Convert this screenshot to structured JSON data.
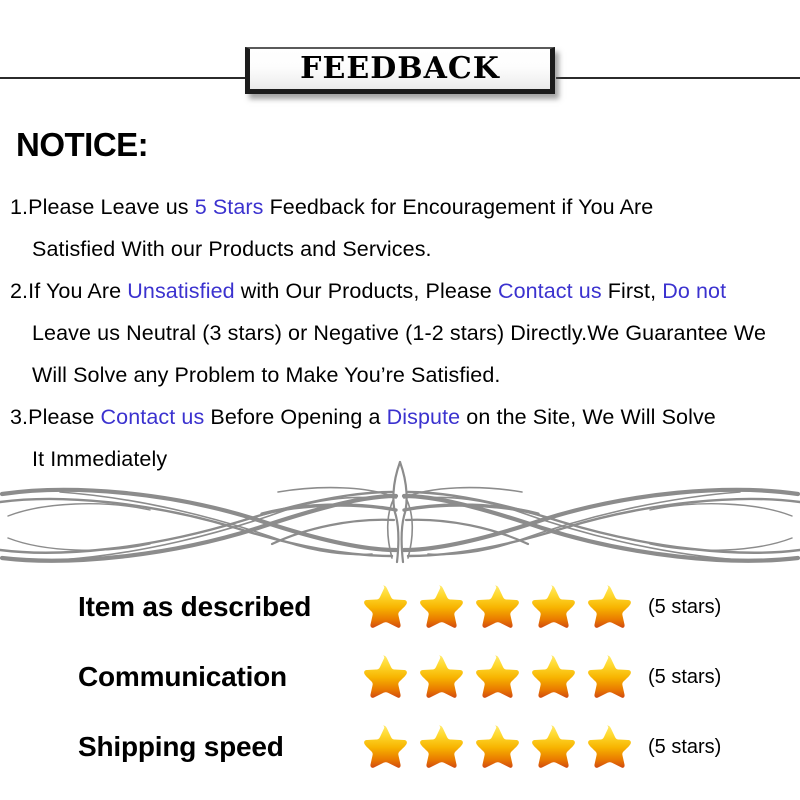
{
  "banner": {
    "title": "FEEDBACK"
  },
  "notice": {
    "heading": "NOTICE:",
    "lines": [
      {
        "segments": [
          {
            "text": "1.Please Leave us ",
            "highlight": false
          },
          {
            "text": " 5 Stars ",
            "highlight": true
          },
          {
            "text": " Feedback for  Encouragement  if You Are",
            "highlight": false
          }
        ]
      },
      {
        "indent": true,
        "segments": [
          {
            "text": "Satisfied With our Products and Services.",
            "highlight": false
          }
        ]
      },
      {
        "segments": [
          {
            "text": "2.If You Are ",
            "highlight": false
          },
          {
            "text": "Unsatisfied",
            "highlight": true
          },
          {
            "text": " with Our Products, Please ",
            "highlight": false
          },
          {
            "text": "Contact us",
            "highlight": true
          },
          {
            "text": " First, ",
            "highlight": false
          },
          {
            "text": "Do not",
            "highlight": true
          }
        ]
      },
      {
        "indent": true,
        "segments": [
          {
            "text": "Leave us Neutral (3 stars) or Negative (1-2 stars) Directly.We Guarantee We",
            "highlight": false
          }
        ]
      },
      {
        "indent": true,
        "segments": [
          {
            "text": "Will Solve any Problem to Make You’re  Satisfied.",
            "highlight": false
          }
        ]
      },
      {
        "segments": [
          {
            "text": "3.Please ",
            "highlight": false
          },
          {
            "text": "Contact us",
            "highlight": true
          },
          {
            "text": " Before Opening a ",
            "highlight": false
          },
          {
            "text": "Dispute",
            "highlight": true
          },
          {
            "text": " on the Site, We Will Solve",
            "highlight": false
          }
        ]
      },
      {
        "indent": true,
        "segments": [
          {
            "text": "It Immediately",
            "highlight": false
          }
        ]
      }
    ]
  },
  "divider": {
    "icon": "flourish-ornament-icon",
    "color": "#8c8c8c"
  },
  "ratings": [
    {
      "label": "Item as described",
      "stars": 5,
      "count_label": "(5 stars)"
    },
    {
      "label": "Communication",
      "stars": 5,
      "count_label": "(5 stars)"
    },
    {
      "label": "Shipping speed",
      "stars": 5,
      "count_label": "(5 stars)"
    }
  ],
  "colors": {
    "highlight_blue": "#3b32cf",
    "star_top": "#ffe14d",
    "star_mid": "#f5b000",
    "star_bottom": "#e06a00",
    "star_tip": "#cf3a12",
    "rule": "#2b2b2b",
    "background": "#ffffff"
  }
}
